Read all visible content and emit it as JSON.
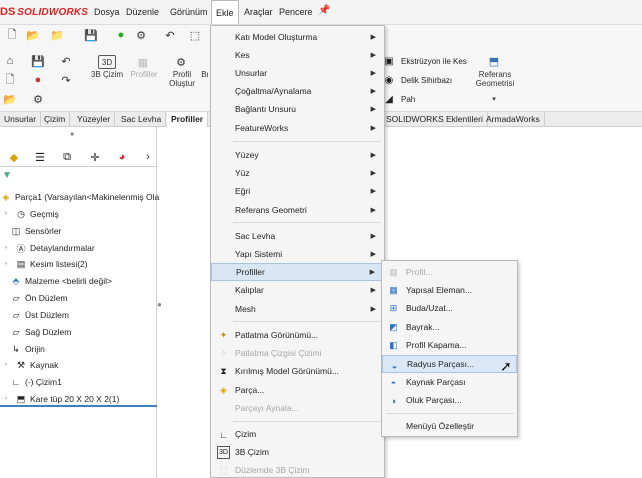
{
  "app": {
    "brand": "SOLIDWORKS",
    "logo_mark": "DS"
  },
  "menubar": [
    {
      "label": "Dosya",
      "open": false
    },
    {
      "label": "Düzenle",
      "open": false
    },
    {
      "label": "Görünüm",
      "open": false
    },
    {
      "label": "Ekle",
      "open": true
    },
    {
      "label": "Araçlar",
      "open": false
    },
    {
      "label": "Pencere",
      "open": false
    }
  ],
  "toolbar": {
    "sketch3d_label": "3B Çizim",
    "profiles_label": "Profiller",
    "profile_create_label": "Profil\nOluştur",
    "ref_geometry_label": "Referans\nGeometrisi",
    "extrude_cut": "Ekstrüzyon ile Kes",
    "hole_wizard": "Delik Sihirbazı",
    "tab": "Pah"
  },
  "cm_tabs": [
    {
      "label": "Unsurlar",
      "active": false
    },
    {
      "label": "Çizim",
      "active": false
    },
    {
      "label": "Yüzeyler",
      "active": false
    },
    {
      "label": "Sac Levha",
      "active": false
    },
    {
      "label": "Profiller",
      "active": true
    },
    {
      "label": "SOLIDWORKS Eklentileri",
      "active": false
    },
    {
      "label": "ArmadaWorks",
      "active": false
    }
  ],
  "feature_tree": {
    "root": "Parça1 (Varsayılan<Makinelenmiş Ola",
    "items": [
      {
        "label": "Geçmiş",
        "icon": "history-icon"
      },
      {
        "label": "Sensörler",
        "icon": "sensor-icon"
      },
      {
        "label": "Detaylandırmalar",
        "icon": "annotation-icon"
      },
      {
        "label": "Kesim listesi(2)",
        "icon": "cutlist-icon"
      },
      {
        "label": "Malzeme <belirli değil>",
        "icon": "material-icon"
      },
      {
        "label": "Ön Düzlem",
        "icon": "plane-icon"
      },
      {
        "label": "Üst Düzlem",
        "icon": "plane-icon"
      },
      {
        "label": "Sağ Düzlem",
        "icon": "plane-icon"
      },
      {
        "label": "Orijin",
        "icon": "origin-icon"
      },
      {
        "label": "Kaynak",
        "icon": "weld-icon"
      },
      {
        "label": "(-) Çizim1",
        "icon": "sketch-icon"
      },
      {
        "label": "Kare tüp 20 X 20 X 2(1)",
        "icon": "structural-icon"
      }
    ]
  },
  "ekle_menu": {
    "items": [
      {
        "label": "Katı Model Oluşturma",
        "submenu": true
      },
      {
        "label": "Kes",
        "submenu": true
      },
      {
        "label": "Unsurlar",
        "submenu": true
      },
      {
        "label": "Çoğaltma/Aynalama",
        "submenu": true
      },
      {
        "label": "Bağlantı Unsuru",
        "submenu": true
      },
      {
        "label": "FeatureWorks",
        "submenu": true
      },
      {
        "label": "Yüzey",
        "submenu": true
      },
      {
        "label": "Yüz",
        "submenu": true
      },
      {
        "label": "Eğri",
        "submenu": true
      },
      {
        "label": "Referans Geometri",
        "submenu": true
      },
      {
        "label": "Sac Levha",
        "submenu": true
      },
      {
        "label": "Yapı Sistemi",
        "submenu": true
      },
      {
        "label": "Profiller",
        "submenu": true,
        "highlighted": true
      },
      {
        "label": "Kalıplar",
        "submenu": true
      },
      {
        "label": "Mesh",
        "submenu": true
      },
      {
        "label": "Patlatma Görünümü...",
        "submenu": false
      },
      {
        "label": "Patlatma Çizgisi Çizimi",
        "submenu": false,
        "disabled": true
      },
      {
        "label": "Kırılmış Model Görünümü...",
        "submenu": false
      },
      {
        "label": "Parça...",
        "submenu": false
      },
      {
        "label": "Parçayı Aynala...",
        "submenu": false,
        "disabled": true
      },
      {
        "label": "Çizim",
        "submenu": false
      },
      {
        "label": "3B Çizim",
        "submenu": false
      },
      {
        "label": "Düzlemde 3B Çizim",
        "submenu": false,
        "disabled": true
      }
    ]
  },
  "profiller_submenu": {
    "items": [
      {
        "label": "Profil...",
        "disabled": true
      },
      {
        "label": "Yapısal Eleman..."
      },
      {
        "label": "Buda/Uzat..."
      },
      {
        "label": "Bayrak..."
      },
      {
        "label": "Profil Kapama..."
      },
      {
        "label": "Radyus Parçası...",
        "highlighted": true
      },
      {
        "label": "Kaynak Parçası"
      },
      {
        "label": "Oluk Parçası..."
      },
      {
        "label": "Menüyü Özelleştir"
      }
    ]
  }
}
